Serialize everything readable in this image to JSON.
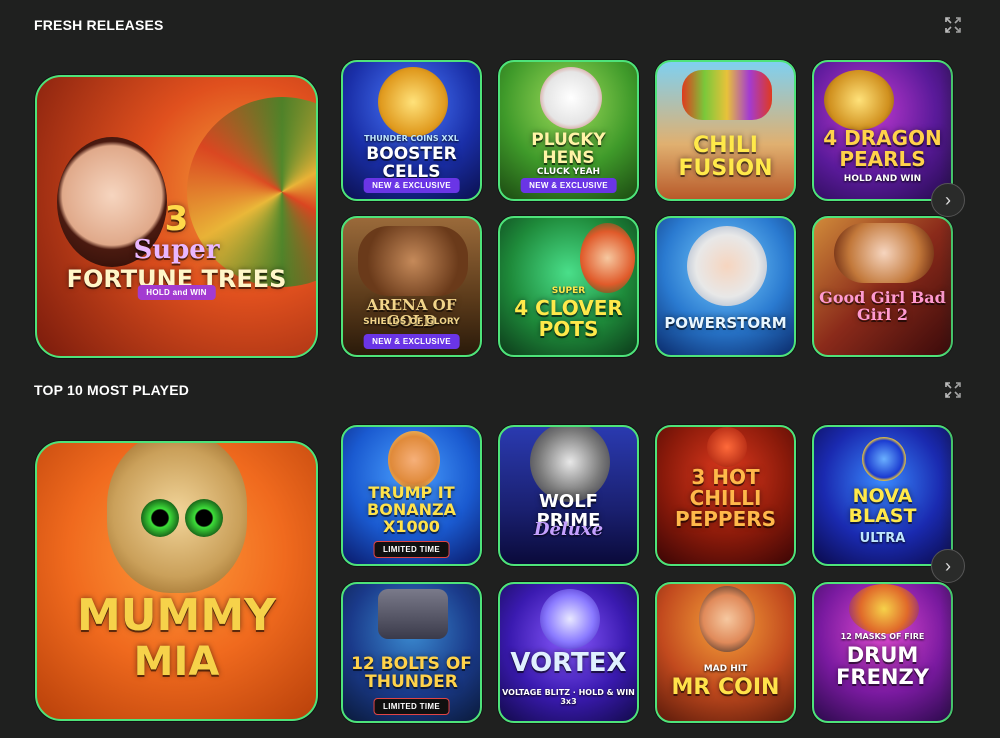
{
  "sections": [
    {
      "title": "FRESH RELEASES",
      "featured": {
        "name_line1": "3",
        "name_line2": "Super",
        "name_line3": "FORTUNE TREES",
        "sub": "HOLD and WIN"
      },
      "games": [
        {
          "name": "BOOSTER CELLS",
          "sub": "THUNDER COINS XXL",
          "badge": "NEW & EXCLUSIVE"
        },
        {
          "name": "PLUCKY HENS",
          "sub": "CLUCK YEAH",
          "badge": "NEW & EXCLUSIVE"
        },
        {
          "name": "CHILI FUSION",
          "sub": "",
          "badge": ""
        },
        {
          "name": "4 DRAGON PEARLS",
          "sub": "HOLD AND WIN",
          "badge": ""
        },
        {
          "name": "ARENA OF GOLD",
          "sub": "SHIELDS OF GLORY",
          "badge": "NEW & EXCLUSIVE"
        },
        {
          "name": "4 CLOVER POTS",
          "sub": "SUPER",
          "badge": ""
        },
        {
          "name": "POWERSTORM",
          "sub": "",
          "badge": ""
        },
        {
          "name": "Good Girl Bad Girl 2",
          "sub": "",
          "badge": ""
        }
      ]
    },
    {
      "title": "TOP 10 MOST PLAYED",
      "featured": {
        "name_line1": "MUMMY",
        "name_line2": "MIA",
        "name_line3": "",
        "sub": ""
      },
      "games": [
        {
          "name": "TRUMP IT BONANZA X1000",
          "sub": "",
          "badge": "LIMITED TIME"
        },
        {
          "name": "WOLF PRIME",
          "sub": "Deluxe",
          "badge": ""
        },
        {
          "name": "3 HOT CHILLI PEPPERS",
          "sub": "",
          "badge": ""
        },
        {
          "name": "NOVA BLAST",
          "sub": "ULTRA",
          "badge": ""
        },
        {
          "name": "12 BOLTS OF THUNDER",
          "sub": "",
          "badge": "LIMITED TIME"
        },
        {
          "name": "VORTEX",
          "sub": "VOLTAGE BLITZ · HOLD & WIN 3x3",
          "badge": ""
        },
        {
          "name": "MR COIN",
          "sub": "MAD HIT",
          "badge": ""
        },
        {
          "name": "DRUM FRENZY",
          "sub": "12 MASKS OF FIRE",
          "badge": ""
        }
      ]
    }
  ],
  "icons": {
    "expand": "expand-icon",
    "next": "chevron-right-icon"
  },
  "colors": {
    "background": "#1f201f",
    "tile_border": "#4ee37a",
    "badge_exclusive": "#6a35e6"
  }
}
